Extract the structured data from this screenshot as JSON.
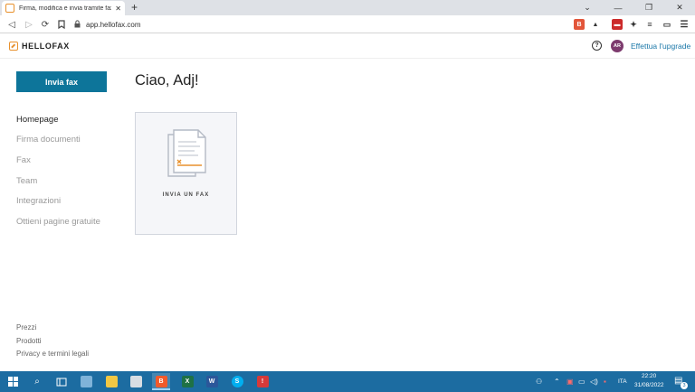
{
  "browser": {
    "tab_title": "Firma, modifica e invia tramite fax",
    "url": "app.hellofax.com",
    "tab_close": "✕",
    "new_tab": "+",
    "window": {
      "minimize": "—",
      "restore": "❐",
      "close": "✕"
    }
  },
  "app": {
    "logo_text": "HELLOFAX",
    "avatar_initials": "AR",
    "upgrade_label": "Effettua l'upgrade",
    "help_glyph": "?"
  },
  "sidebar": {
    "send_fax_label": "Invia fax",
    "nav": [
      {
        "label": "Homepage",
        "active": true
      },
      {
        "label": "Firma documenti",
        "active": false
      },
      {
        "label": "Fax",
        "active": false
      },
      {
        "label": "Team",
        "active": false
      },
      {
        "label": "Integrazioni",
        "active": false
      },
      {
        "label": "Ottieni pagine gratuite",
        "active": false
      }
    ],
    "footer": [
      "Prezzi",
      "Prodotti",
      "Privacy e termini legali"
    ]
  },
  "main": {
    "greeting": "Ciao, Adj!",
    "card_label": "INVIA UN FAX"
  },
  "taskbar": {
    "language": "ITA",
    "time": "22:20",
    "date": "31/08/2022",
    "notification_count": "3"
  },
  "colors": {
    "accent": "#0d759a",
    "brand_orange": "#e8912d",
    "link": "#1a77a8",
    "taskbar": "#1c6ca1",
    "avatar": "#7d3b6e"
  }
}
